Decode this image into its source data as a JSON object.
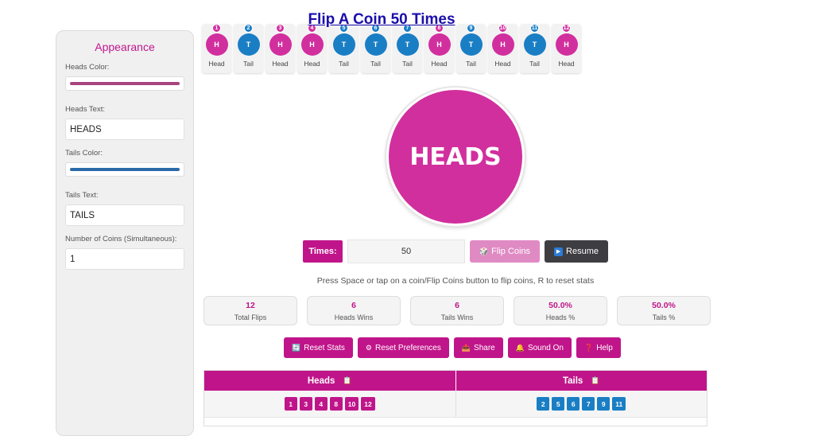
{
  "page": {
    "title": "Flip A Coin 50 Times"
  },
  "colors": {
    "heads": "#d12f9e",
    "tails": "#1a7ec5",
    "accent": "#c0158a",
    "flip_button": "#e08ac4",
    "resume_button": "#3d3d42",
    "heads_swatch": "#a8437d",
    "tails_swatch": "#2a6aa8"
  },
  "sidebar": {
    "title": "Appearance",
    "heads_color_label": "Heads Color:",
    "heads_text_label": "Heads Text:",
    "heads_text_value": "HEADS",
    "tails_color_label": "Tails Color:",
    "tails_text_label": "Tails Text:",
    "tails_text_value": "TAILS",
    "coins_label": "Number of Coins (Simultaneous):",
    "coins_value": "1"
  },
  "history": [
    {
      "num": "1",
      "face": "H",
      "label": "Head"
    },
    {
      "num": "2",
      "face": "T",
      "label": "Tail"
    },
    {
      "num": "3",
      "face": "H",
      "label": "Head"
    },
    {
      "num": "4",
      "face": "H",
      "label": "Head"
    },
    {
      "num": "5",
      "face": "T",
      "label": "Tail"
    },
    {
      "num": "6",
      "face": "T",
      "label": "Tail"
    },
    {
      "num": "7",
      "face": "T",
      "label": "Tail"
    },
    {
      "num": "8",
      "face": "H",
      "label": "Head"
    },
    {
      "num": "9",
      "face": "T",
      "label": "Tail"
    },
    {
      "num": "10",
      "face": "H",
      "label": "Head"
    },
    {
      "num": "11",
      "face": "T",
      "label": "Tail"
    },
    {
      "num": "12",
      "face": "H",
      "label": "Head"
    }
  ],
  "coin": {
    "text": "HEADS"
  },
  "controls": {
    "times_label": "Times:",
    "times_value": "50",
    "flip_label": "Flip Coins",
    "flip_icon": "🎲",
    "resume_label": "Resume",
    "resume_icon": "▶"
  },
  "hint": "Press Space or tap on a coin/Flip Coins button to flip coins, R to reset stats",
  "stats": [
    {
      "value": "12",
      "label": "Total Flips"
    },
    {
      "value": "6",
      "label": "Heads Wins"
    },
    {
      "value": "6",
      "label": "Tails Wins"
    },
    {
      "value": "50.0%",
      "label": "Heads %"
    },
    {
      "value": "50.0%",
      "label": "Tails %"
    }
  ],
  "actions": [
    {
      "icon": "🔄",
      "label": "Reset Stats",
      "name": "reset-stats-button"
    },
    {
      "icon": "⚙",
      "label": "Reset Preferences",
      "name": "reset-preferences-button"
    },
    {
      "icon": "📤",
      "label": "Share",
      "name": "share-button"
    },
    {
      "icon": "🔔",
      "label": "Sound On",
      "name": "sound-toggle-button"
    },
    {
      "icon": "❓",
      "label": "Help",
      "name": "help-button"
    }
  ],
  "results": {
    "heads_header": "Heads",
    "tails_header": "Tails",
    "copy_icon": "📋",
    "heads_flips": [
      "1",
      "3",
      "4",
      "8",
      "10",
      "12"
    ],
    "tails_flips": [
      "2",
      "5",
      "6",
      "7",
      "9",
      "11"
    ]
  }
}
